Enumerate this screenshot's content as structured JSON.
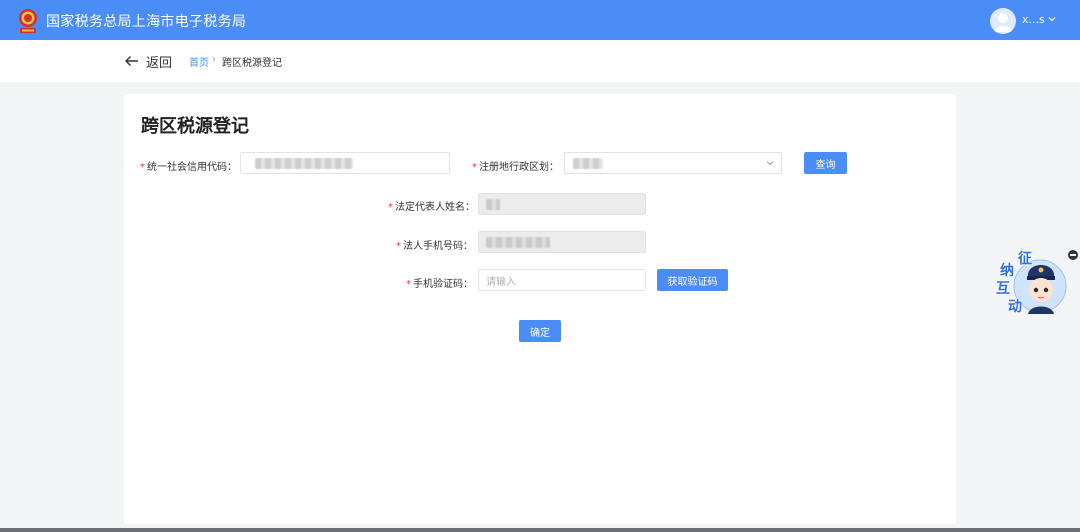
{
  "header": {
    "site_title": "国家税务总局上海市电子税务局",
    "username": "x...s"
  },
  "breadcrumb": {
    "back_label": "返回",
    "home": "首页",
    "separator": "›",
    "current": "跨区税源登记"
  },
  "form": {
    "title": "跨区税源登记",
    "credit_code_label": "统一社会信用代码：",
    "region_label": "注册地行政区划：",
    "query_button": "查询",
    "legal_name_label": "法定代表人姓名：",
    "legal_phone_label": "法人手机号码：",
    "sms_code_label": "手机验证码：",
    "sms_code_placeholder": "请输入",
    "get_code_button": "获取验证码",
    "confirm_button": "确定",
    "required_mark": "*"
  },
  "assistant": {
    "chars": [
      "征",
      "纳",
      "互",
      "动"
    ]
  },
  "colors": {
    "header_bg": "#4b8df7",
    "primary": "#4b8df7",
    "required": "#e53935",
    "page_bg": "#f3f4f6"
  }
}
